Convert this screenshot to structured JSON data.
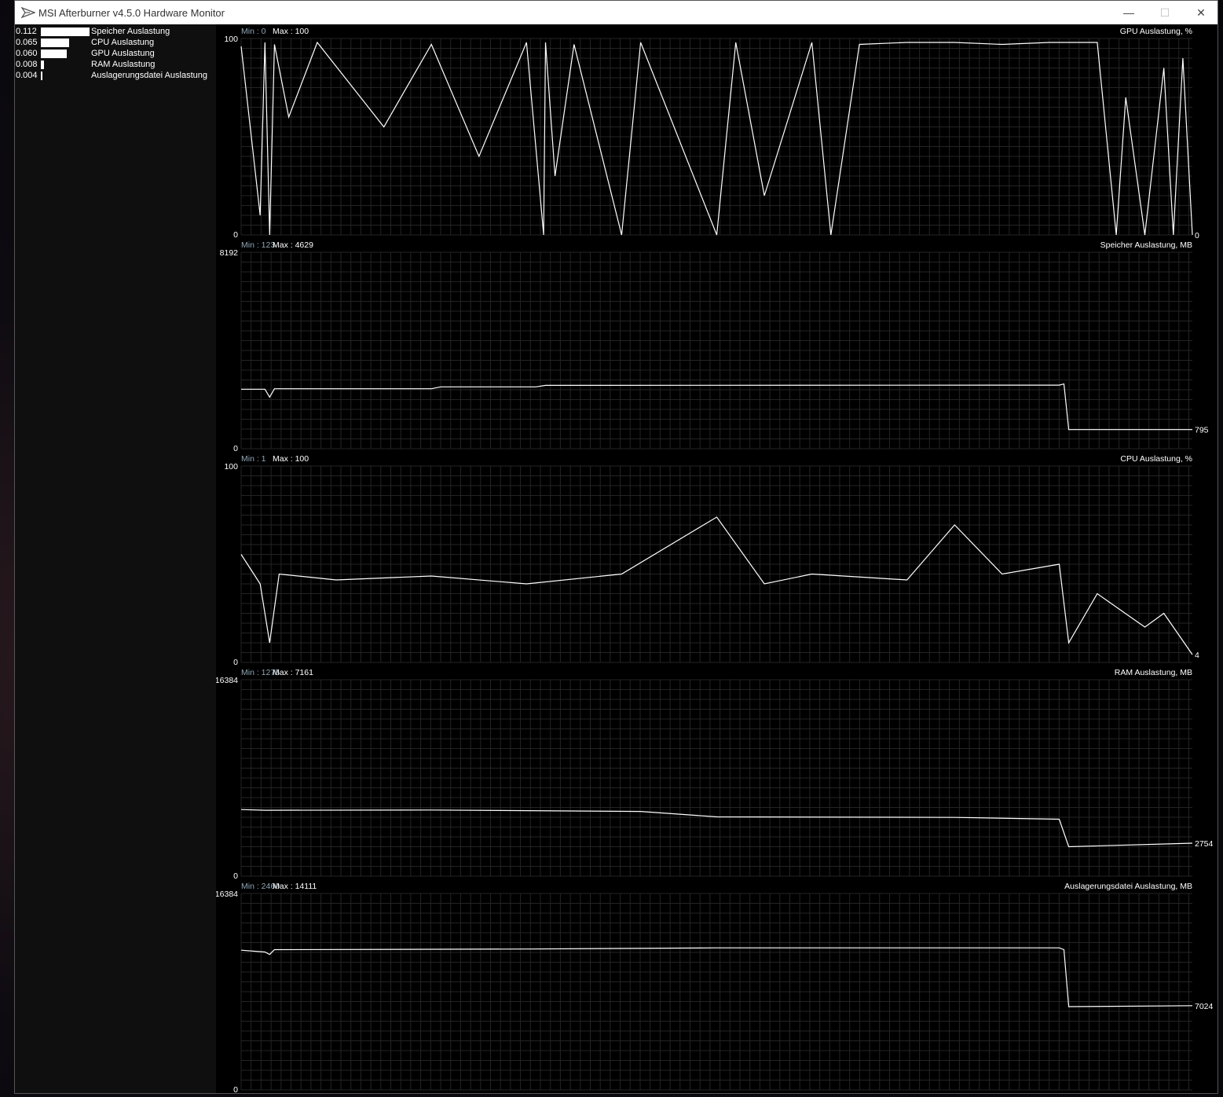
{
  "window": {
    "title": "MSI Afterburner v4.5.0 Hardware Monitor",
    "minimize_glyph": "—",
    "maximize_glyph": "☐",
    "close_glyph": "✕"
  },
  "icons": {
    "app": "afterburner-plane-icon",
    "minimize": "minimize-icon",
    "maximize": "maximize-icon",
    "close": "close-icon"
  },
  "colors": {
    "background": "#000000",
    "sidebar": "#0f0f0f",
    "grid": "#242424",
    "trace": "#ffffff",
    "min_label": "#8fa6b4",
    "text": "#ffffff"
  },
  "sources": [
    {
      "value": "0.112",
      "name": "Speicher Auslastung",
      "fraction": 0.112
    },
    {
      "value": "0.065",
      "name": "CPU Auslastung",
      "fraction": 0.065
    },
    {
      "value": "0.060",
      "name": "GPU Auslastung",
      "fraction": 0.06
    },
    {
      "value": "0.008",
      "name": "RAM Auslastung",
      "fraction": 0.008
    },
    {
      "value": "0.004",
      "name": "Auslagerungsdatei Auslastung",
      "fraction": 0.004
    }
  ],
  "chart_data": [
    {
      "type": "line",
      "title": "GPU Auslastung, %",
      "min_label": "Min : 0",
      "max_label": "Max : 100",
      "ylim": [
        0,
        100
      ],
      "ytick_top": "100",
      "ytick_bottom": "0",
      "current": "0",
      "current_value": 0,
      "grid": true,
      "x": [
        0,
        0.02,
        0.025,
        0.03,
        0.035,
        0.05,
        0.08,
        0.15,
        0.2,
        0.25,
        0.3,
        0.318,
        0.32,
        0.33,
        0.35,
        0.4,
        0.42,
        0.5,
        0.52,
        0.55,
        0.6,
        0.62,
        0.65,
        0.7,
        0.75,
        0.8,
        0.85,
        0.9,
        0.92,
        0.93,
        0.95,
        0.97,
        0.98,
        0.99,
        1.0
      ],
      "values": [
        96,
        10,
        98,
        0,
        97,
        60,
        98,
        55,
        97,
        40,
        98,
        0,
        98,
        30,
        97,
        0,
        98,
        0,
        98,
        20,
        98,
        0,
        97,
        98,
        98,
        97,
        98,
        98,
        0,
        70,
        0,
        85,
        0,
        90,
        0
      ]
    },
    {
      "type": "line",
      "title": "Speicher Auslastung, MB",
      "min_label": "Min : 123",
      "max_label": "Max : 4629",
      "ylim": [
        0,
        8192
      ],
      "ytick_top": "8192",
      "ytick_bottom": "0",
      "current": "795",
      "current_value": 795,
      "grid": true,
      "x": [
        0,
        0.025,
        0.03,
        0.035,
        0.2,
        0.21,
        0.31,
        0.32,
        0.86,
        0.865,
        0.87,
        1.0
      ],
      "values": [
        2480,
        2480,
        2150,
        2500,
        2500,
        2580,
        2580,
        2640,
        2650,
        2700,
        795,
        795
      ]
    },
    {
      "type": "line",
      "title": "CPU Auslastung, %",
      "min_label": "Min : 1",
      "max_label": "Max : 100",
      "ylim": [
        0,
        100
      ],
      "ytick_top": "100",
      "ytick_bottom": "0",
      "current": "4",
      "current_value": 4,
      "grid": true,
      "x": [
        0,
        0.02,
        0.03,
        0.04,
        0.1,
        0.2,
        0.3,
        0.4,
        0.5,
        0.55,
        0.6,
        0.7,
        0.75,
        0.8,
        0.86,
        0.87,
        0.9,
        0.95,
        0.97,
        1.0
      ],
      "values": [
        55,
        40,
        10,
        45,
        42,
        44,
        40,
        45,
        74,
        40,
        45,
        42,
        70,
        45,
        50,
        10,
        35,
        18,
        25,
        4
      ]
    },
    {
      "type": "line",
      "title": "RAM Auslastung, MB",
      "min_label": "Min : 1275",
      "max_label": "Max : 7161",
      "ylim": [
        0,
        16384
      ],
      "ytick_top": "16384",
      "ytick_bottom": "0",
      "current": "2754",
      "current_value": 2754,
      "grid": true,
      "x": [
        0,
        0.025,
        0.2,
        0.42,
        0.5,
        0.75,
        0.86,
        0.87,
        1.0
      ],
      "values": [
        5560,
        5500,
        5520,
        5400,
        4950,
        4900,
        4750,
        2460,
        2754
      ]
    },
    {
      "type": "line",
      "title": "Auslagerungsdatei Auslastung, MB",
      "min_label": "Min : 2460",
      "max_label": "Max : 14111",
      "ylim": [
        0,
        16384
      ],
      "ytick_top": "16384",
      "ytick_bottom": "0",
      "current": "7024",
      "current_value": 7024,
      "grid": true,
      "x": [
        0,
        0.025,
        0.03,
        0.035,
        0.3,
        0.5,
        0.86,
        0.865,
        0.87,
        1.0
      ],
      "values": [
        11650,
        11500,
        11300,
        11700,
        11750,
        11850,
        11850,
        11700,
        6950,
        7024
      ]
    }
  ]
}
